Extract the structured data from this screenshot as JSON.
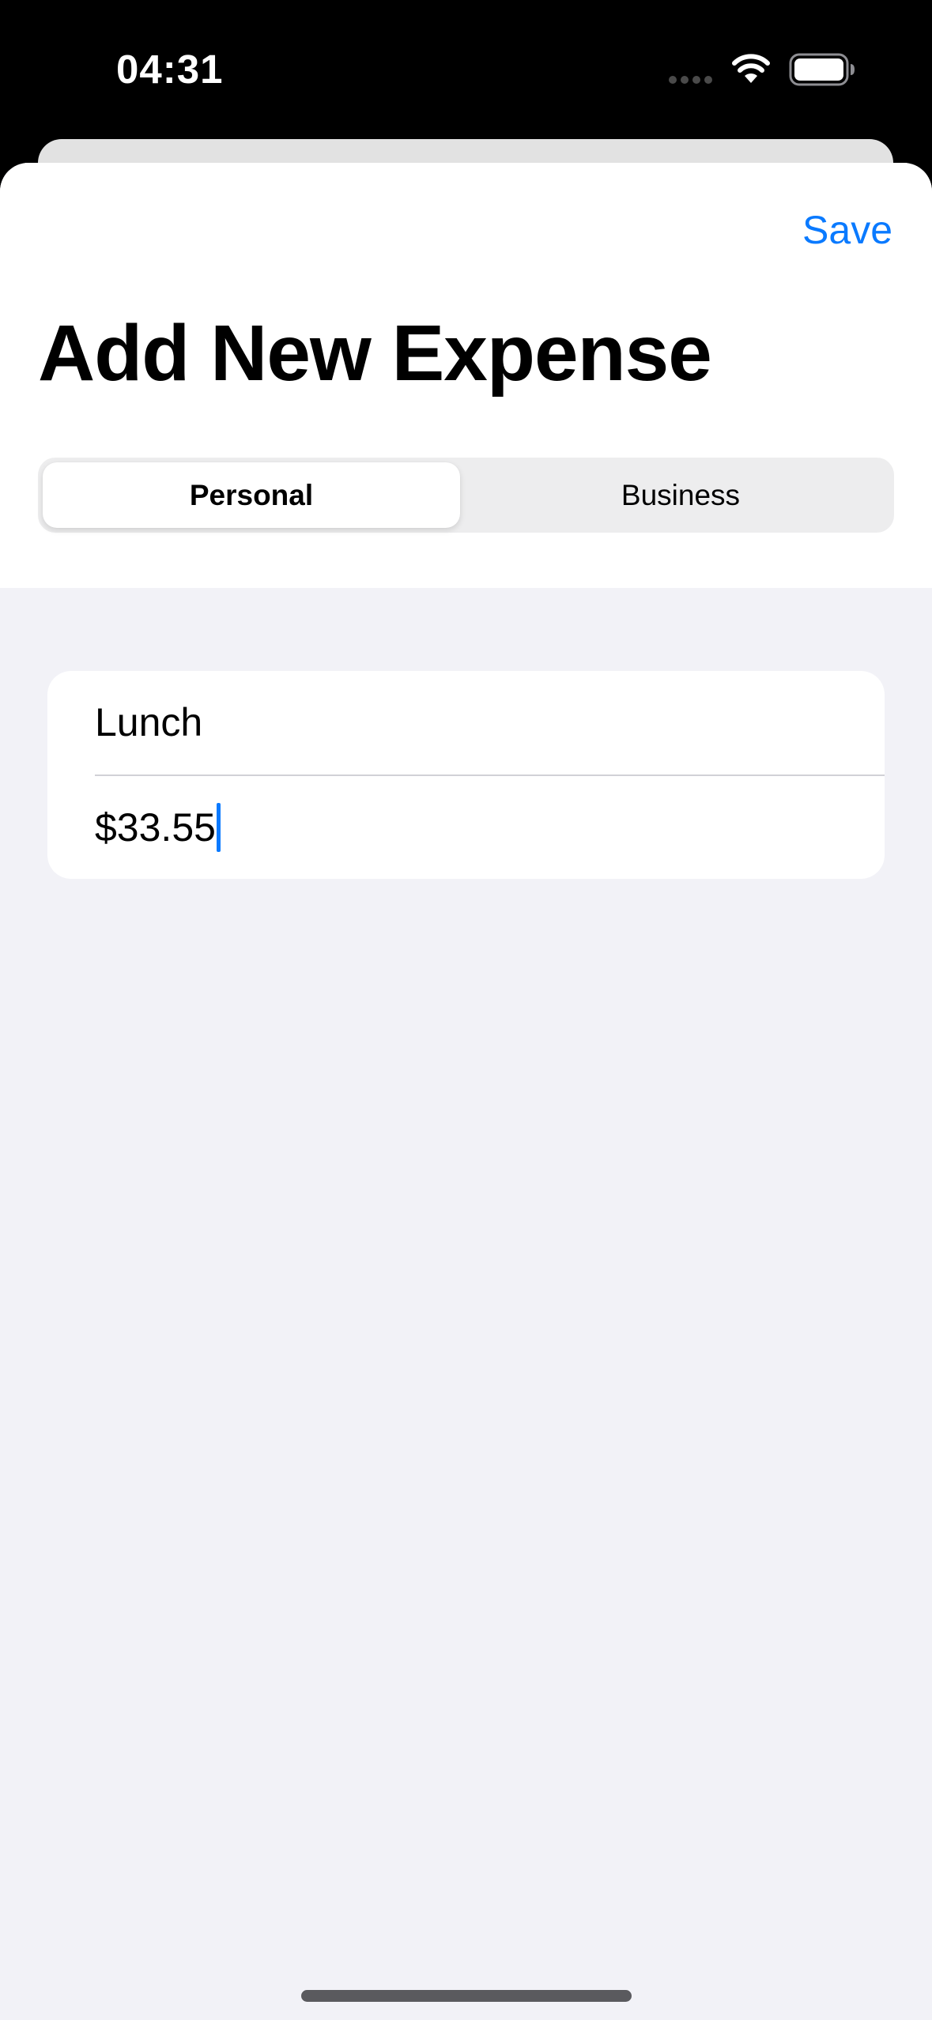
{
  "status_bar": {
    "time": "04:31",
    "icons": [
      "cellular-dots-icon",
      "wifi-icon",
      "battery-icon"
    ]
  },
  "header": {
    "save_label": "Save",
    "title": "Add New Expense"
  },
  "segmented_control": {
    "options": [
      "Personal",
      "Business"
    ],
    "selected": "Personal"
  },
  "form": {
    "name_value": "Lunch",
    "amount_value": "$33.55"
  },
  "colors": {
    "accent": "#0a7aff",
    "sheet_background": "#f2f2f7",
    "status_bar_background": "#000000"
  }
}
